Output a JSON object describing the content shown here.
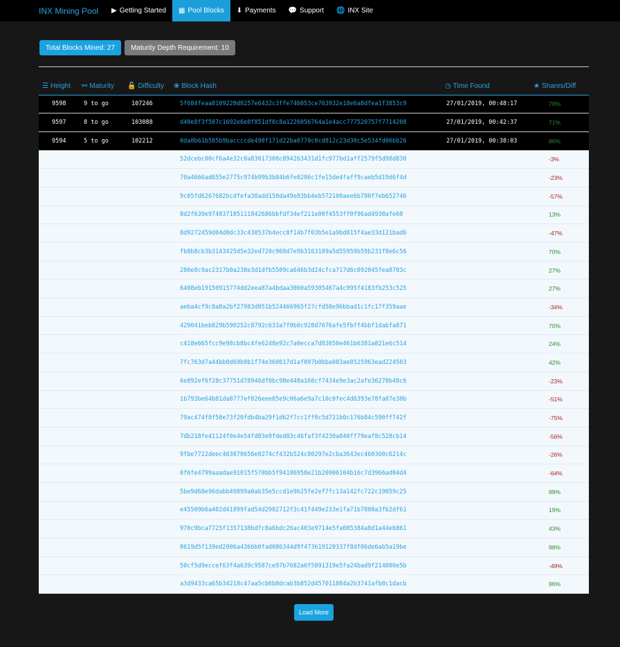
{
  "nav": {
    "brand": "INX Mining Pool",
    "items": [
      {
        "label": "Getting Started",
        "icon": "play-icon",
        "glyph": "▶",
        "active": false
      },
      {
        "label": "Pool Blocks",
        "icon": "table-icon",
        "glyph": "▦",
        "active": true
      },
      {
        "label": "Payments",
        "icon": "download-circle-icon",
        "glyph": "⬇",
        "active": false
      },
      {
        "label": "Support",
        "icon": "comments-icon",
        "glyph": "💬",
        "active": false
      },
      {
        "label": "INX Site",
        "icon": "globe-icon",
        "glyph": "🌐",
        "active": false
      }
    ]
  },
  "badges": {
    "total_blocks": "Total Blocks Mined: 27",
    "maturity_depth": "Maturity Depth Requirement: 10"
  },
  "table": {
    "headers": {
      "height": "Height",
      "maturity": "Maturity",
      "difficulty": "Difficulty",
      "block_hash": "Block Hash",
      "time_found": "Time Found",
      "shares_diff": "Shares/Diff"
    },
    "pending_rows": [
      {
        "height": "9598",
        "maturity": "9 to go",
        "difficulty": "107246",
        "hash": "5f684feaa8109220d8257e6432c3ffe746053ce763932e18e6a8dfea1f3853c9",
        "time": "27/01/2019, 00:48:17",
        "shares": "70%"
      },
      {
        "height": "9597",
        "maturity": "8 to go",
        "difficulty": "103088",
        "hash": "d40e8f3f507c1692e6e8f851df0c8a1226056764a1e4acc777520757f7714208",
        "time": "27/01/2019, 00:42:37",
        "shares": "71%"
      },
      {
        "height": "9594",
        "maturity": "5 to go",
        "difficulty": "102212",
        "hash": "0da8b61b585b9baccccde490f171d22ba0770c0cd812c23d30c5e534fd06bb26",
        "time": "27/01/2019, 00:38:03",
        "shares": "86%"
      }
    ],
    "confirmed_rows": [
      {
        "hash": "52dcebc00cf6a4e32c0a83017308c894263431d1fc977bd1aff2579f5d98d830",
        "shares": "-3%"
      },
      {
        "hash": "70a4666ad655e2775c974b99b3b84b6fe0286c1fe15de4faff9caeb5d19d6f4d",
        "shares": "-23%"
      },
      {
        "hash": "9c05fd6267682bcdfefa38add150da49e83bb4eb572100aee6b780f7eb652746",
        "shares": "-57%"
      },
      {
        "hash": "8d2f639e974837105111842686bbfdf34ef211e00f4553ff0f96ad4938afe60",
        "shares": "13%"
      },
      {
        "hash": "8d9272459d04d0dc33c430537b4ecc8f14b7f03b5e1a9bd815f4ae33d121bad6",
        "shares": "-47%"
      },
      {
        "hash": "fb8b8cb3b3143425d5e32ed720c969d7e9b3163189a5d55959b59b231f8e6c56",
        "shares": "70%"
      },
      {
        "hash": "280e8c9ac2317b0a238e3d1dfb5509ca646b3d24cfca717d6c092045fea8703c",
        "shares": "27%"
      },
      {
        "hash": "6408eb19150915774dd2eea87a4bdaa3060a59305467a4c995f4183fb253c525",
        "shares": "27%"
      },
      {
        "hash": "aeba4cf9c8a8a2bf27983d051b524466965f27cfd58e96bbad1c1fc17f359aae",
        "shares": "-34%"
      },
      {
        "hash": "429041beb829b590252c8792c633a7f0b0c928d7676afe5fbff4bbf1dabfa871",
        "shares": "70%"
      },
      {
        "hash": "c418e665fcc9e98cb8bc4fe6248e92c7a0ecca7d83050e461b6381a821e6c514",
        "shares": "24%"
      },
      {
        "hash": "7fc763d7a44bb0d69b8b1f74e360617d1af097b0bba083ae0525963ead224503",
        "shares": "42%"
      },
      {
        "hash": "6e892ef6f28c37751d78946df0bc98e448a168cf7434e9e3ac2afe36270b48c6",
        "shares": "-23%"
      },
      {
        "hash": "1b793be64b81da0777ef026eee85e9c06a6e9a7c10c0fec4d6393e78fa07e30b",
        "shares": "-51%"
      },
      {
        "hash": "79ac474f8f58e73f20fdb4ba29f1d62f7cc1ff0c5d721b0c176b84c590ff742f",
        "shares": "-75%"
      },
      {
        "hash": "7db218fe41124f0e4e54fd83e9fded83c46faf3f4230a840ff79eaf8c528cb14",
        "shares": "-56%"
      },
      {
        "hash": "9fbe7722deec463870656e0274cf432b524c80297e2cba3643ec460360c6214c",
        "shares": "-26%"
      },
      {
        "hash": "0f6fe4799aaadae91015f570bb5f94186958e21b20906104b16c7d3966ad04d4",
        "shares": "-64%"
      },
      {
        "hash": "5be9d68e96dabb49899a0ab35e5ccd1e9b25fe2ef7fc13a142fc722c19059c25",
        "shares": "99%"
      },
      {
        "hash": "e45509b6a402d41899fad54d2902712f3c41f449e233e1fa71b7808a3fb2df61",
        "shares": "19%"
      },
      {
        "hash": "970c9bca7725f1357138bdfc8a6bdc26ac403e9714e5fa085384a8d1a44eb861",
        "shares": "43%"
      },
      {
        "hash": "8619d5f139ed2006a4366b0fad086344d9f473619120337f8df06de6ab5a19be",
        "shares": "98%"
      },
      {
        "hash": "50cf5d9eccef63f4a639c9587ce97b7682a6f5891319e5fa24bad9f214800e5b",
        "shares": "-49%"
      },
      {
        "hash": "a3d9433ca65b34218c47aa5cb6b8dcab3b852d457011884a2b3741afb8c1dacb",
        "shares": "96%"
      }
    ]
  },
  "load_more_label": "Load More",
  "colors": {
    "accent": "#1aa3e0",
    "positive": "#2f8a2f",
    "negative": "#b02020"
  }
}
